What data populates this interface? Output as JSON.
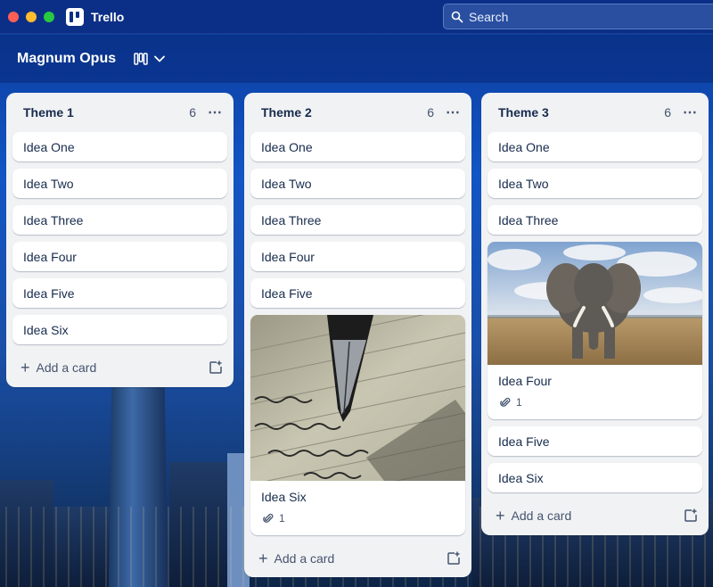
{
  "app": {
    "name": "Trello"
  },
  "search": {
    "placeholder": "Search"
  },
  "board": {
    "title": "Magnum Opus"
  },
  "lists": [
    {
      "title": "Theme 1",
      "count": "6",
      "cards": [
        "Idea One",
        "Idea Two",
        "Idea Three",
        "Idea Four",
        "Idea Five",
        "Idea Six"
      ],
      "add_label": "Add a card"
    },
    {
      "title": "Theme 2",
      "count": "6",
      "cards": [
        "Idea One",
        "Idea Two",
        "Idea Three",
        "Idea Four",
        "Idea Five"
      ],
      "cover_card": {
        "title": "Idea Six",
        "attachments": "1",
        "image": "fountain-pen-writing-photo"
      },
      "add_label": "Add a card"
    },
    {
      "title": "Theme 3",
      "count": "6",
      "cards_before": [
        "Idea One",
        "Idea Two",
        "Idea Three"
      ],
      "cover_card": {
        "title": "Idea Four",
        "attachments": "1",
        "image": "elephant-savanna-photo"
      },
      "cards_after": [
        "Idea Five",
        "Idea Six"
      ],
      "add_label": "Add a card"
    }
  ],
  "colors": {
    "header": "#0b2f86",
    "list_bg": "#f1f2f4",
    "text": "#172b4d"
  }
}
